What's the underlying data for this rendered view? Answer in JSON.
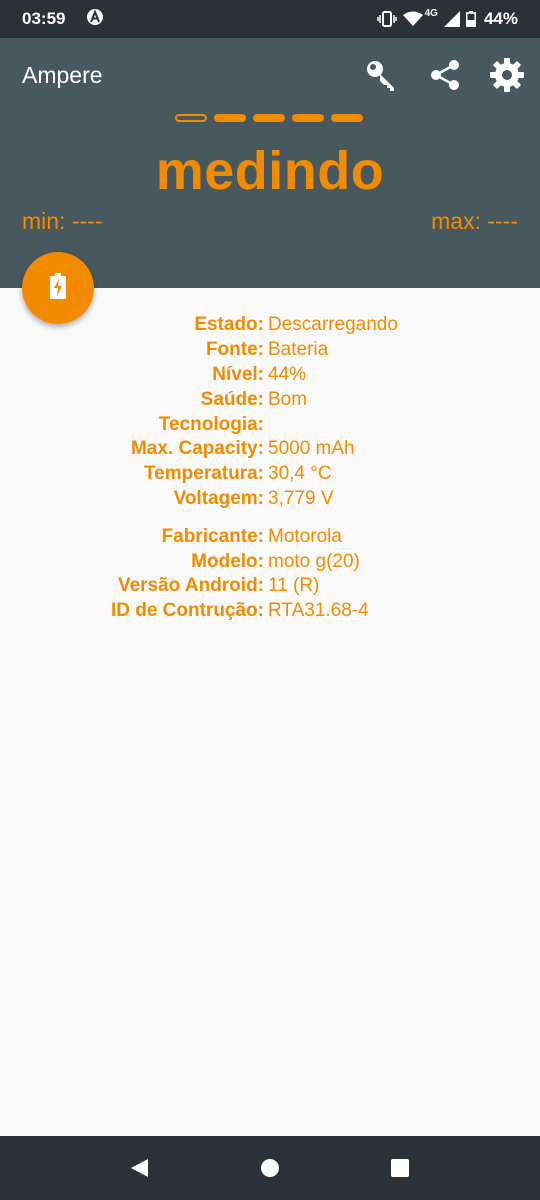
{
  "status_bar": {
    "time": "03:59",
    "network": "4G",
    "battery": "44%"
  },
  "app": {
    "title": "Ampere",
    "toolbar": {
      "icons": [
        "key-icon",
        "share-icon",
        "settings-gear-icon"
      ]
    },
    "measure_status": "medindo",
    "min": "min: ----",
    "max": "max: ----",
    "accent_color": "#f38b00",
    "header_color": "#47585f"
  },
  "info": {
    "battery": [
      {
        "label": "Estado:",
        "value": "Descarregando"
      },
      {
        "label": "Fonte:",
        "value": "Bateria"
      },
      {
        "label": "Nível:",
        "value": "44%"
      },
      {
        "label": "Saúde:",
        "value": "Bom"
      },
      {
        "label": "Tecnologia:",
        "value": ""
      },
      {
        "label": "Max. Capacity:",
        "value": "5000 mAh"
      },
      {
        "label": "Temperatura:",
        "value": "30,4 °C"
      },
      {
        "label": "Voltagem:",
        "value": "3,779 V"
      }
    ],
    "device": [
      {
        "label": "Fabricante:",
        "value": "Motorola"
      },
      {
        "label": "Modelo:",
        "value": "moto g(20)"
      },
      {
        "label": "Versão Android:",
        "value": "11 (R)"
      },
      {
        "label": "ID de Contrução:",
        "value": "RTA31.68-4"
      }
    ]
  }
}
